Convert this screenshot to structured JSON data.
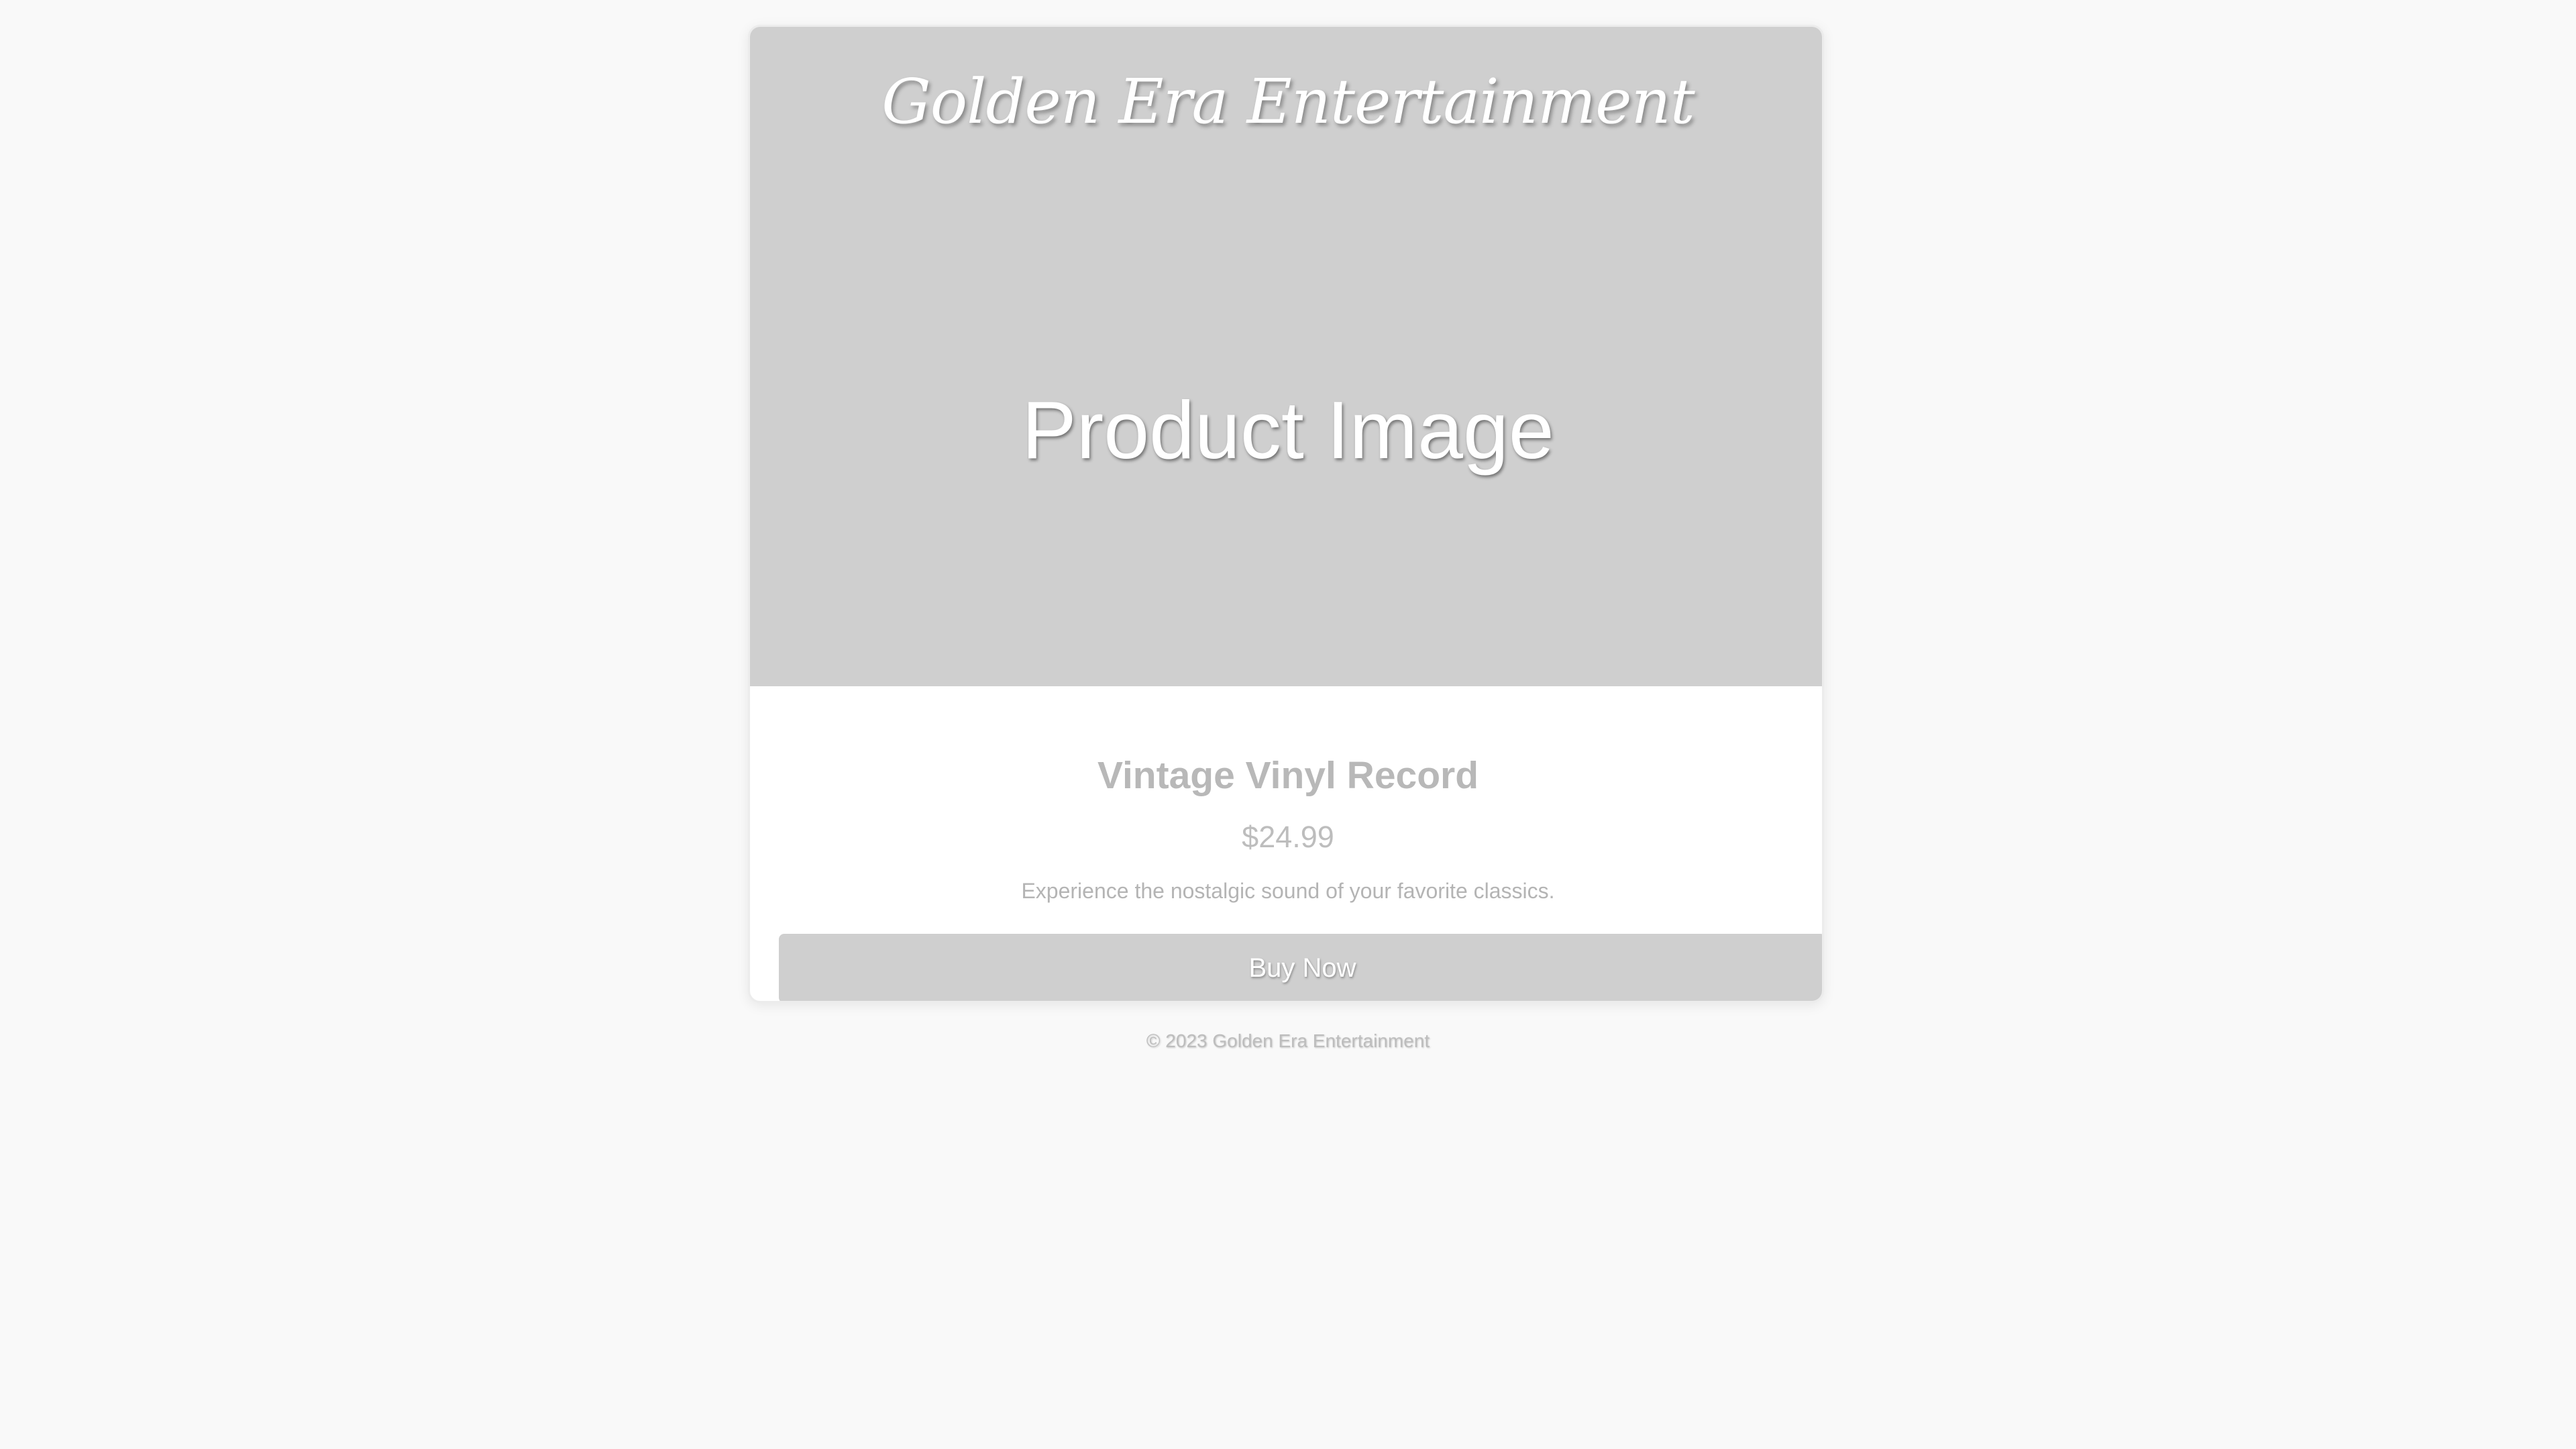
{
  "header": {
    "brand_name": "Golden Era Entertainment"
  },
  "product": {
    "image_placeholder": "Product Image",
    "title": "Vintage Vinyl Record",
    "price": "$24.99",
    "description": "Experience the nostalgic sound of your favorite classics.",
    "buy_label": "Buy Now"
  },
  "footer": {
    "copyright": "© 2023 Golden Era Entertainment"
  },
  "colors": {
    "page_background": "#f9f9f9",
    "card_background": "#ffffff",
    "placeholder_gray": "#cfcfcf",
    "text_muted": "#b8b8b8"
  }
}
